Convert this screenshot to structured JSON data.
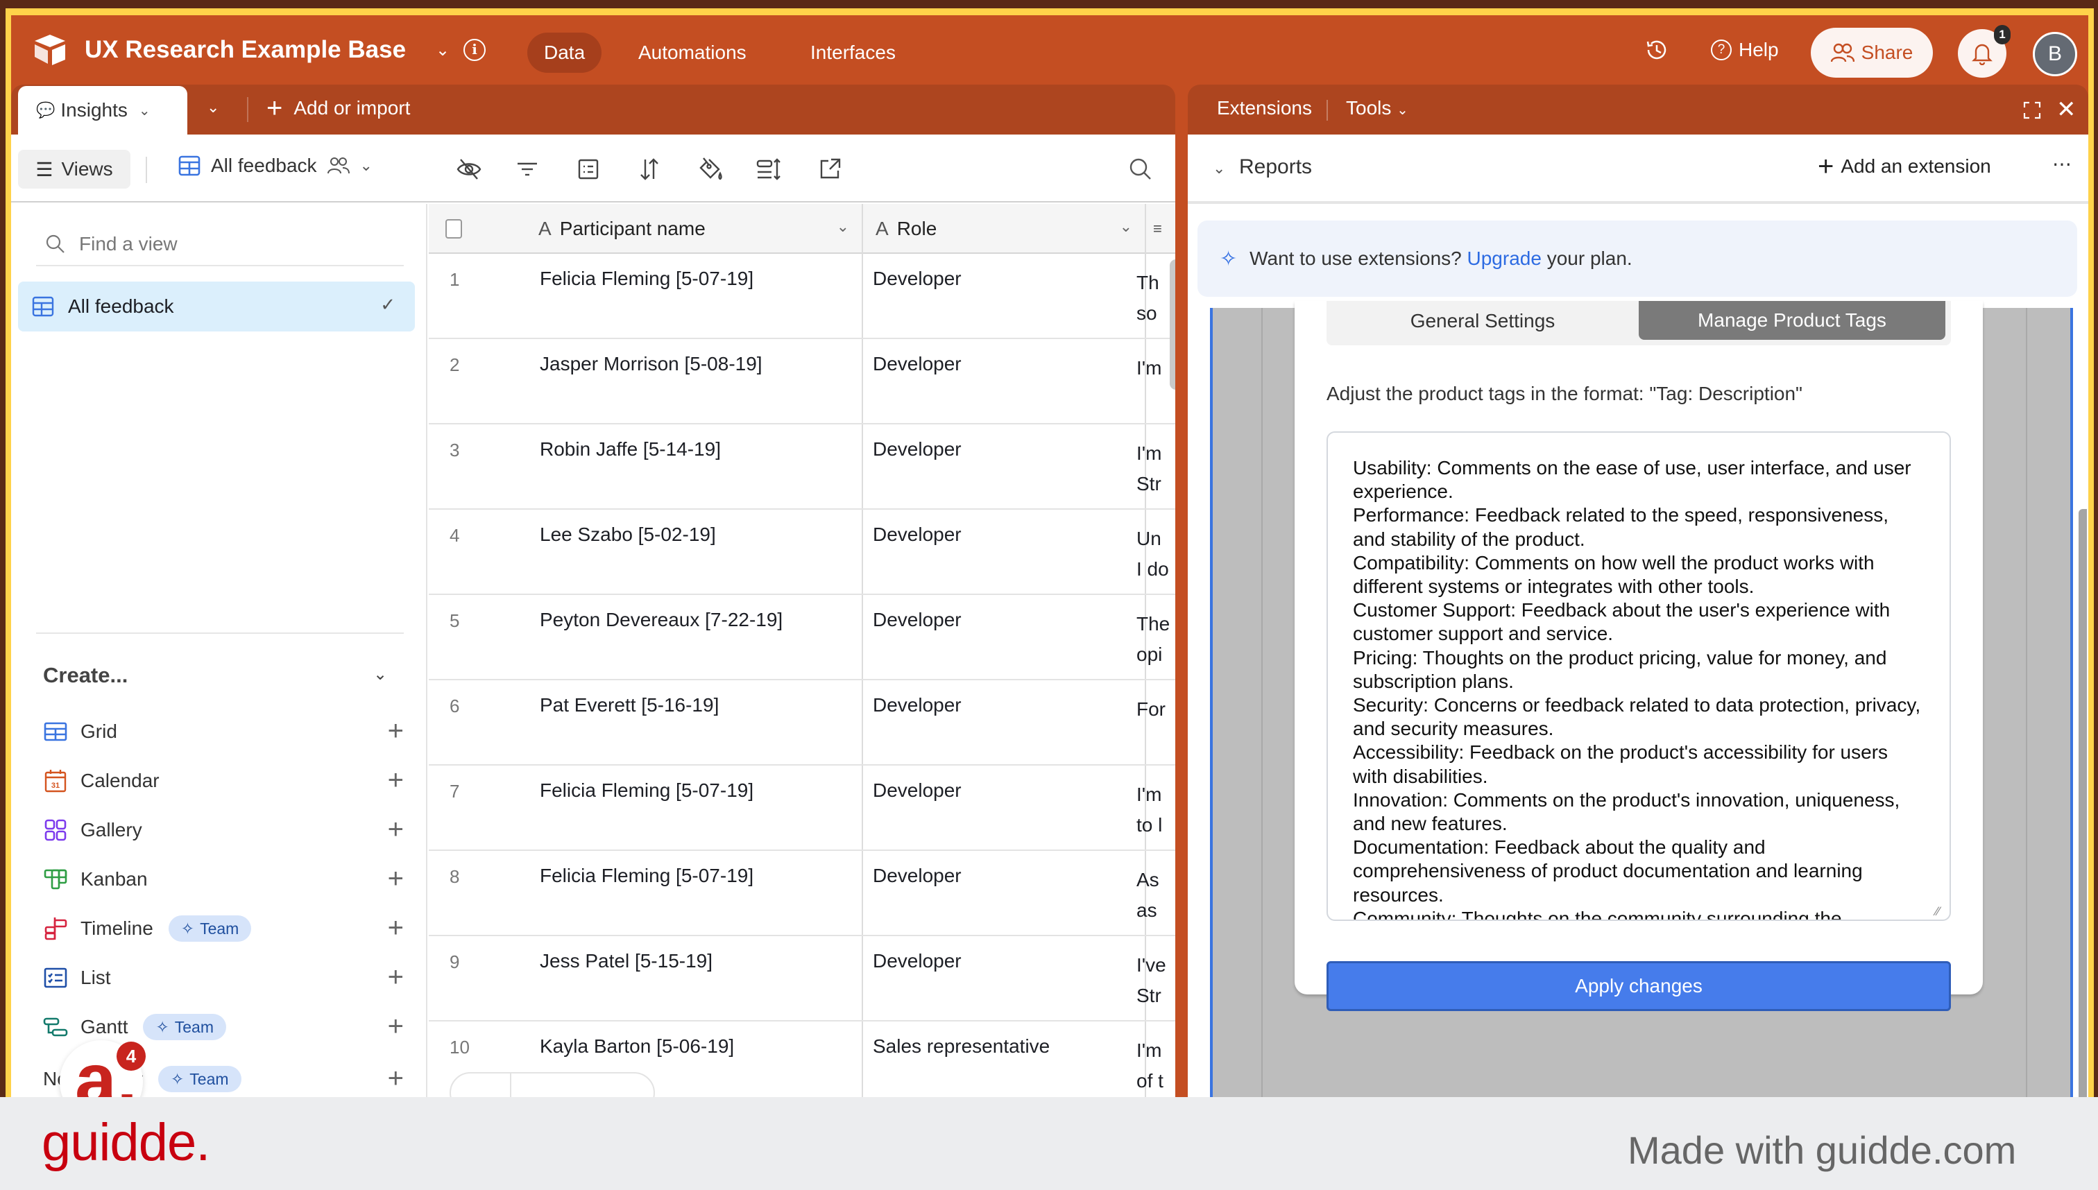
{
  "header": {
    "base_title": "UX Research Example Base",
    "nav": [
      {
        "label": "Data",
        "active": true
      },
      {
        "label": "Automations",
        "active": false
      },
      {
        "label": "Interfaces",
        "active": false
      }
    ],
    "help_label": "Help",
    "share_label": "Share",
    "notification_count": "1",
    "avatar_initial": "B"
  },
  "tabs": {
    "active_table": "Insights",
    "add_or_import": "Add or import"
  },
  "toolbar": {
    "views_label": "Views",
    "current_view": "All feedback"
  },
  "sidebar": {
    "find_placeholder": "Find a view",
    "views": [
      {
        "label": "All feedback",
        "selected": true
      }
    ],
    "create_header": "Create...",
    "create_items": [
      {
        "label": "Grid",
        "icon": "grid-icon",
        "badge": null
      },
      {
        "label": "Calendar",
        "icon": "calendar-icon",
        "badge": null
      },
      {
        "label": "Gallery",
        "icon": "gallery-icon",
        "badge": null
      },
      {
        "label": "Kanban",
        "icon": "kanban-icon",
        "badge": null
      },
      {
        "label": "Timeline",
        "icon": "timeline-icon",
        "badge": "Team"
      },
      {
        "label": "List",
        "icon": "list-icon",
        "badge": null
      },
      {
        "label": "Gantt",
        "icon": "gantt-icon",
        "badge": "Team"
      },
      {
        "label": "New section",
        "icon": null,
        "badge": "Team"
      }
    ]
  },
  "grid": {
    "columns": [
      "Participant name",
      "Role"
    ],
    "rows": [
      {
        "num": "1",
        "name": "Felicia Fleming [5-07-19]",
        "role": "Developer",
        "feedback": "Th\nso"
      },
      {
        "num": "2",
        "name": "Jasper Morrison [5-08-19]",
        "role": "Developer",
        "feedback": "I'm"
      },
      {
        "num": "3",
        "name": "Robin Jaffe [5-14-19]",
        "role": "Developer",
        "feedback": "I'm\nStr"
      },
      {
        "num": "4",
        "name": "Lee Szabo [5-02-19]",
        "role": "Developer",
        "feedback": "Un\nI do"
      },
      {
        "num": "5",
        "name": "Peyton Devereaux [7-22-19]",
        "role": "Developer",
        "feedback": "The\nopi"
      },
      {
        "num": "6",
        "name": "Pat Everett [5-16-19]",
        "role": "Developer",
        "feedback": "For"
      },
      {
        "num": "7",
        "name": "Felicia Fleming [5-07-19]",
        "role": "Developer",
        "feedback": "I'm\nto l"
      },
      {
        "num": "8",
        "name": "Felicia Fleming [5-07-19]",
        "role": "Developer",
        "feedback": "As\nas"
      },
      {
        "num": "9",
        "name": "Jess Patel [5-15-19]",
        "role": "Developer",
        "feedback": "I've\nStr"
      },
      {
        "num": "10",
        "name": "Kayla Barton [5-06-19]",
        "role": "Sales representative",
        "feedback": "I'm\nof t"
      }
    ]
  },
  "extensions": {
    "title": "Extensions",
    "tools_label": "Tools",
    "dashboard_name": "Reports",
    "add_extension": "Add an extension",
    "upgrade_prefix": "Want to use extensions?",
    "upgrade_link": "Upgrade",
    "upgrade_suffix": "your plan.",
    "tabs": [
      {
        "label": "General Settings",
        "active": false
      },
      {
        "label": "Manage Product Tags",
        "active": true
      }
    ],
    "instructions": "Adjust the product tags in the format: \"Tag: Description\"",
    "tags_text": "Usability: Comments on the ease of use, user interface, and user experience.\nPerformance: Feedback related to the speed, responsiveness, and stability of the product.\nCompatibility: Comments on how well the product works with different systems or integrates with other tools.\nCustomer Support: Feedback about the user's experience with customer support and service.\nPricing: Thoughts on the product pricing, value for money, and subscription plans.\nSecurity: Concerns or feedback related to data protection, privacy, and security measures.\nAccessibility: Feedback on the product's accessibility for users with disabilities.\nInnovation: Comments on the product's innovation, uniqueness, and new features.\nDocumentation: Feedback about the quality and comprehensiveness of product documentation and learning resources.\nCommunity: Thoughts on the community surrounding the",
    "apply_label": "Apply changes"
  },
  "footer": {
    "logo_text": "guidde.",
    "made_with": "Made with guidde.com",
    "bubble_count": "4"
  },
  "colors": {
    "brand_orange": "#C44E22",
    "tab_row": "#AD451F",
    "accent_blue": "#467CEB",
    "team_badge_bg": "#D6E4FA",
    "guidde_red": "#C8000F"
  }
}
